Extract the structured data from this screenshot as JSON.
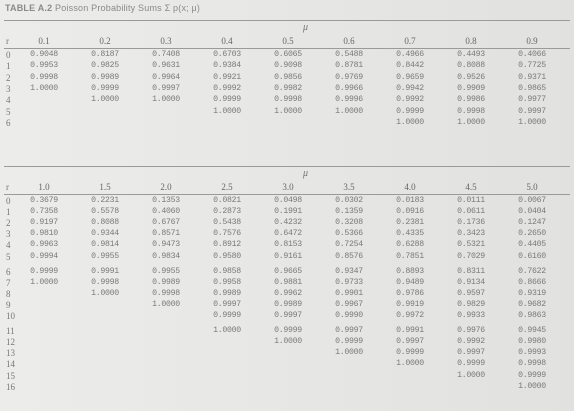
{
  "title": {
    "label": "TABLE A.2",
    "text": "Poisson Probability Sums",
    "formula": "Σ p(x; μ)"
  },
  "table1": {
    "mu_label": "μ",
    "r_label": "r",
    "columns": [
      "0.1",
      "0.2",
      "0.3",
      "0.4",
      "0.5",
      "0.6",
      "0.7",
      "0.8",
      "0.9"
    ],
    "rows": [
      {
        "r": "0",
        "values": [
          "0.9048",
          "0.8187",
          "0.7408",
          "0.6703",
          "0.6065",
          "0.5488",
          "0.4966",
          "0.4493",
          "0.4066"
        ]
      },
      {
        "r": "1",
        "values": [
          "0.9953",
          "0.9825",
          "0.9631",
          "0.9384",
          "0.9098",
          "0.8781",
          "0.8442",
          "0.8088",
          "0.7725"
        ]
      },
      {
        "r": "2",
        "values": [
          "0.9998",
          "0.9989",
          "0.9964",
          "0.9921",
          "0.9856",
          "0.9769",
          "0.9659",
          "0.9526",
          "0.9371"
        ]
      },
      {
        "r": "3",
        "values": [
          "1.0000",
          "0.9999",
          "0.9997",
          "0.9992",
          "0.9982",
          "0.9966",
          "0.9942",
          "0.9909",
          "0.9865"
        ]
      },
      {
        "r": "4",
        "values": [
          "",
          "1.0000",
          "1.0000",
          "0.9999",
          "0.9998",
          "0.9996",
          "0.9992",
          "0.9986",
          "0.9977"
        ]
      },
      {
        "r": "5",
        "values": [
          "",
          "",
          "",
          "1.0000",
          "1.0000",
          "1.0000",
          "0.9999",
          "0.9998",
          "0.9997"
        ]
      },
      {
        "r": "6",
        "values": [
          "",
          "",
          "",
          "",
          "",
          "",
          "1.0000",
          "1.0000",
          "1.0000"
        ]
      }
    ]
  },
  "table2": {
    "mu_label": "μ",
    "r_label": "r",
    "columns": [
      "1.0",
      "1.5",
      "2.0",
      "2.5",
      "3.0",
      "3.5",
      "4.0",
      "4.5",
      "5.0"
    ],
    "rows": [
      {
        "r": "0",
        "values": [
          "0.3679",
          "0.2231",
          "0.1353",
          "0.0821",
          "0.0498",
          "0.0302",
          "0.0183",
          "0.0111",
          "0.0067"
        ]
      },
      {
        "r": "1",
        "values": [
          "0.7358",
          "0.5578",
          "0.4060",
          "0.2873",
          "0.1991",
          "0.1359",
          "0.0916",
          "0.0611",
          "0.0404"
        ]
      },
      {
        "r": "2",
        "values": [
          "0.9197",
          "0.8088",
          "0.6767",
          "0.5438",
          "0.4232",
          "0.3208",
          "0.2381",
          "0.1736",
          "0.1247"
        ]
      },
      {
        "r": "3",
        "values": [
          "0.9810",
          "0.9344",
          "0.8571",
          "0.7576",
          "0.6472",
          "0.5366",
          "0.4335",
          "0.3423",
          "0.2650"
        ]
      },
      {
        "r": "4",
        "values": [
          "0.9963",
          "0.9814",
          "0.9473",
          "0.8912",
          "0.8153",
          "0.7254",
          "0.6288",
          "0.5321",
          "0.4405"
        ]
      },
      {
        "r": "5",
        "values": [
          "0.9994",
          "0.9955",
          "0.9834",
          "0.9580",
          "0.9161",
          "0.8576",
          "0.7851",
          "0.7029",
          "0.6160"
        ]
      },
      {
        "r": "6",
        "values": [
          "0.9999",
          "0.9991",
          "0.9955",
          "0.9858",
          "0.9665",
          "0.9347",
          "0.8893",
          "0.8311",
          "0.7622"
        ]
      },
      {
        "r": "7",
        "values": [
          "1.0000",
          "0.9998",
          "0.9989",
          "0.9958",
          "0.9881",
          "0.9733",
          "0.9489",
          "0.9134",
          "0.8666"
        ]
      },
      {
        "r": "8",
        "values": [
          "",
          "1.0000",
          "0.9998",
          "0.9989",
          "0.9962",
          "0.9901",
          "0.9786",
          "0.9597",
          "0.9319"
        ]
      },
      {
        "r": "9",
        "values": [
          "",
          "",
          "1.0000",
          "0.9997",
          "0.9989",
          "0.9967",
          "0.9919",
          "0.9829",
          "0.9682"
        ]
      },
      {
        "r": "10",
        "values": [
          "",
          "",
          "",
          "0.9999",
          "0.9997",
          "0.9990",
          "0.9972",
          "0.9933",
          "0.9863"
        ]
      },
      {
        "r": "11",
        "values": [
          "",
          "",
          "",
          "1.0000",
          "0.9999",
          "0.9997",
          "0.9991",
          "0.9976",
          "0.9945"
        ]
      },
      {
        "r": "12",
        "values": [
          "",
          "",
          "",
          "",
          "1.0000",
          "0.9999",
          "0.9997",
          "0.9992",
          "0.9980"
        ]
      },
      {
        "r": "13",
        "values": [
          "",
          "",
          "",
          "",
          "",
          "1.0000",
          "0.9999",
          "0.9997",
          "0.9993"
        ]
      },
      {
        "r": "14",
        "values": [
          "",
          "",
          "",
          "",
          "",
          "",
          "1.0000",
          "0.9999",
          "0.9998"
        ]
      },
      {
        "r": "15",
        "values": [
          "",
          "",
          "",
          "",
          "",
          "",
          "",
          "1.0000",
          "0.9999"
        ]
      },
      {
        "r": "16",
        "values": [
          "",
          "",
          "",
          "",
          "",
          "",
          "",
          "",
          "1.0000"
        ]
      }
    ]
  }
}
